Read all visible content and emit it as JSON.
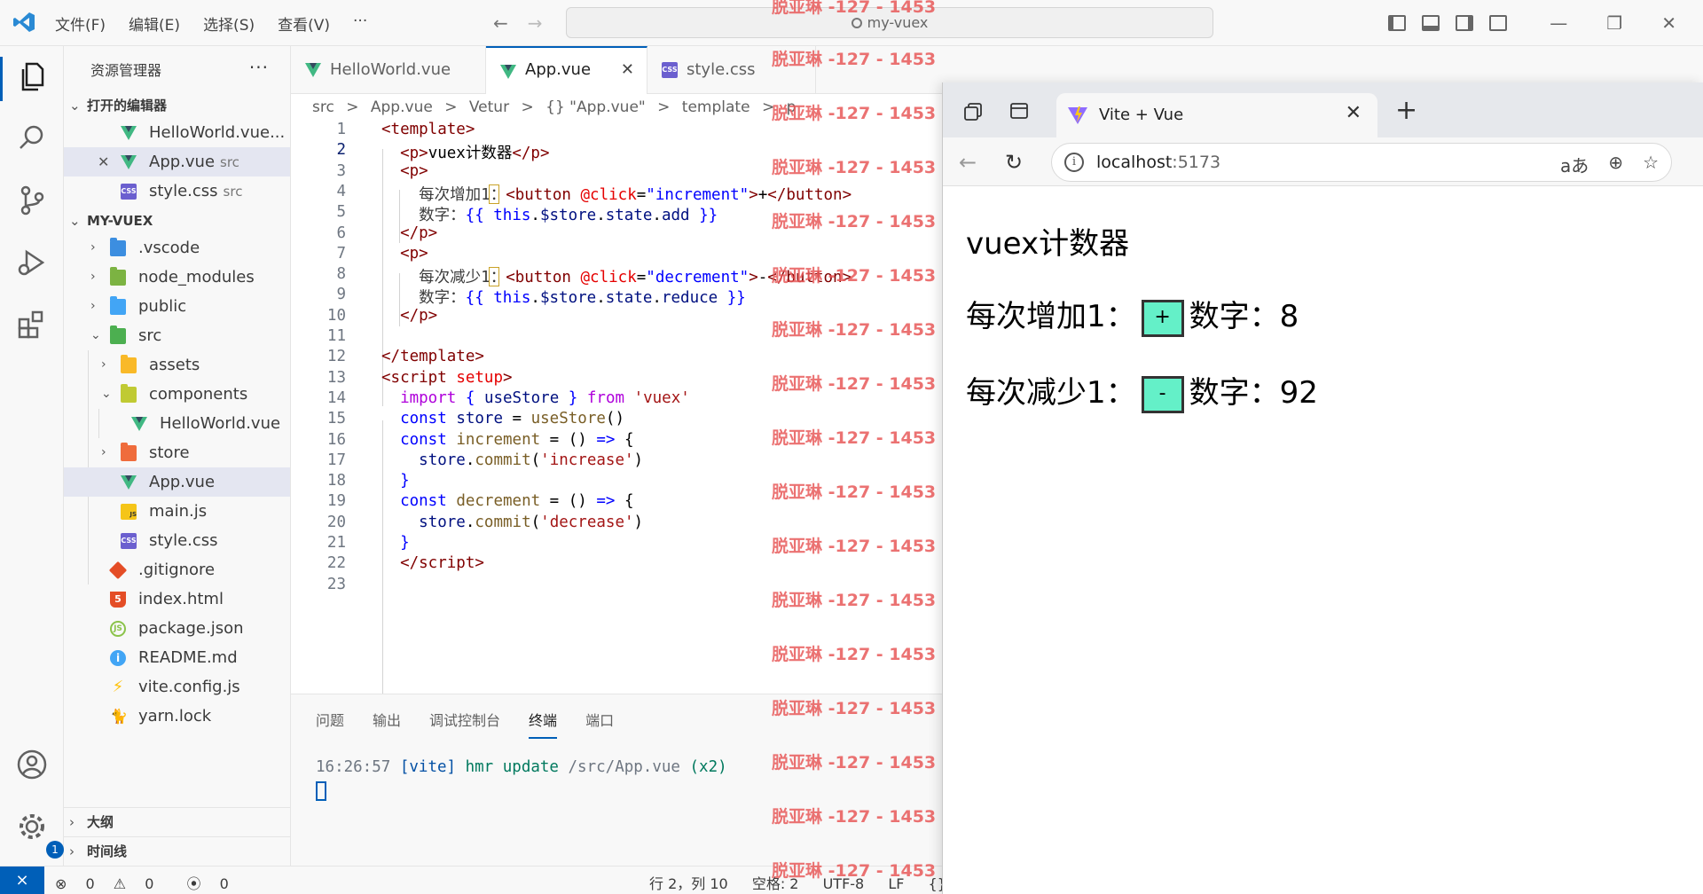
{
  "titlebar": {
    "menus": [
      "文件(F)",
      "编辑(E)",
      "选择(S)",
      "查看(V)",
      "···"
    ],
    "search": "my-vuex"
  },
  "activity": {
    "items": [
      "explorer-icon",
      "search-icon",
      "source-control-icon",
      "run-debug-icon",
      "extensions-icon"
    ],
    "bottom": [
      "account-icon",
      "manage-gear-icon"
    ],
    "settings_badge": "1"
  },
  "sidebar": {
    "title": "资源管理器",
    "more": "···",
    "open_editors": {
      "title": "打开的编辑器",
      "items": [
        {
          "name": "HelloWorld.vue...",
          "desc": ""
        },
        {
          "name": "App.vue",
          "desc": "src"
        },
        {
          "name": "style.css",
          "desc": "src"
        }
      ]
    },
    "project": {
      "title": "MY-VUEX",
      "items": [
        {
          "name": ".vscode"
        },
        {
          "name": "node_modules"
        },
        {
          "name": "public"
        },
        {
          "name": "src"
        },
        {
          "name": "assets"
        },
        {
          "name": "components"
        },
        {
          "name": "HelloWorld.vue"
        },
        {
          "name": "store"
        },
        {
          "name": "App.vue"
        },
        {
          "name": "main.js"
        },
        {
          "name": "style.css"
        },
        {
          "name": ".gitignore"
        },
        {
          "name": "index.html"
        },
        {
          "name": "package.json"
        },
        {
          "name": "README.md"
        },
        {
          "name": "vite.config.js"
        },
        {
          "name": "yarn.lock"
        }
      ]
    },
    "outline": "大纲",
    "timeline": "时间线"
  },
  "editor": {
    "tabs": [
      "HelloWorld.vue",
      "App.vue",
      "style.css"
    ],
    "breadcrumbs": [
      "src",
      ">",
      "App.vue",
      ">",
      "Vetur",
      ">",
      "{} \"App.vue\"",
      ">",
      "template",
      ">",
      "p"
    ],
    "line_numbers": [
      "1",
      "2",
      "3",
      "4",
      "5",
      "6",
      "7",
      "8",
      "9",
      "10",
      "11",
      "12",
      "13",
      "14",
      "15",
      "16",
      "17",
      "18",
      "19",
      "20",
      "21",
      "22",
      "23"
    ]
  },
  "panel": {
    "tabs": [
      "问题",
      "输出",
      "调试控制台",
      "终端",
      "端口"
    ],
    "terminal": {
      "time": "16:26:57",
      "tag": "[vite]",
      "msg": "hmr update",
      "path": "/src/App.vue",
      "count": "(x2)"
    }
  },
  "statusbar": {
    "errors": "0",
    "warnings": "0",
    "ports": "0",
    "position": "行 2，列 10",
    "spaces": "空格: 2",
    "encoding": "UTF-8",
    "eol": "LF",
    "lang": "{}"
  },
  "watermark": "脱亚琳 -127 - 1453",
  "browser": {
    "tab_title": "Vite + Vue",
    "url_host": "localhost",
    "url_port": ":5173",
    "page": {
      "heading": "vuex计数器",
      "inc_label": "每次增加1：",
      "inc_button": "+",
      "inc_value_label": "数字：",
      "inc_value": "8",
      "dec_label": "每次减少1：",
      "dec_button": "-",
      "dec_value_label": "数字：",
      "dec_value": "92"
    }
  },
  "colors": {
    "accent": "#005fb8",
    "button_fill": "#64f0c8",
    "watermark": "#e85a5a"
  }
}
